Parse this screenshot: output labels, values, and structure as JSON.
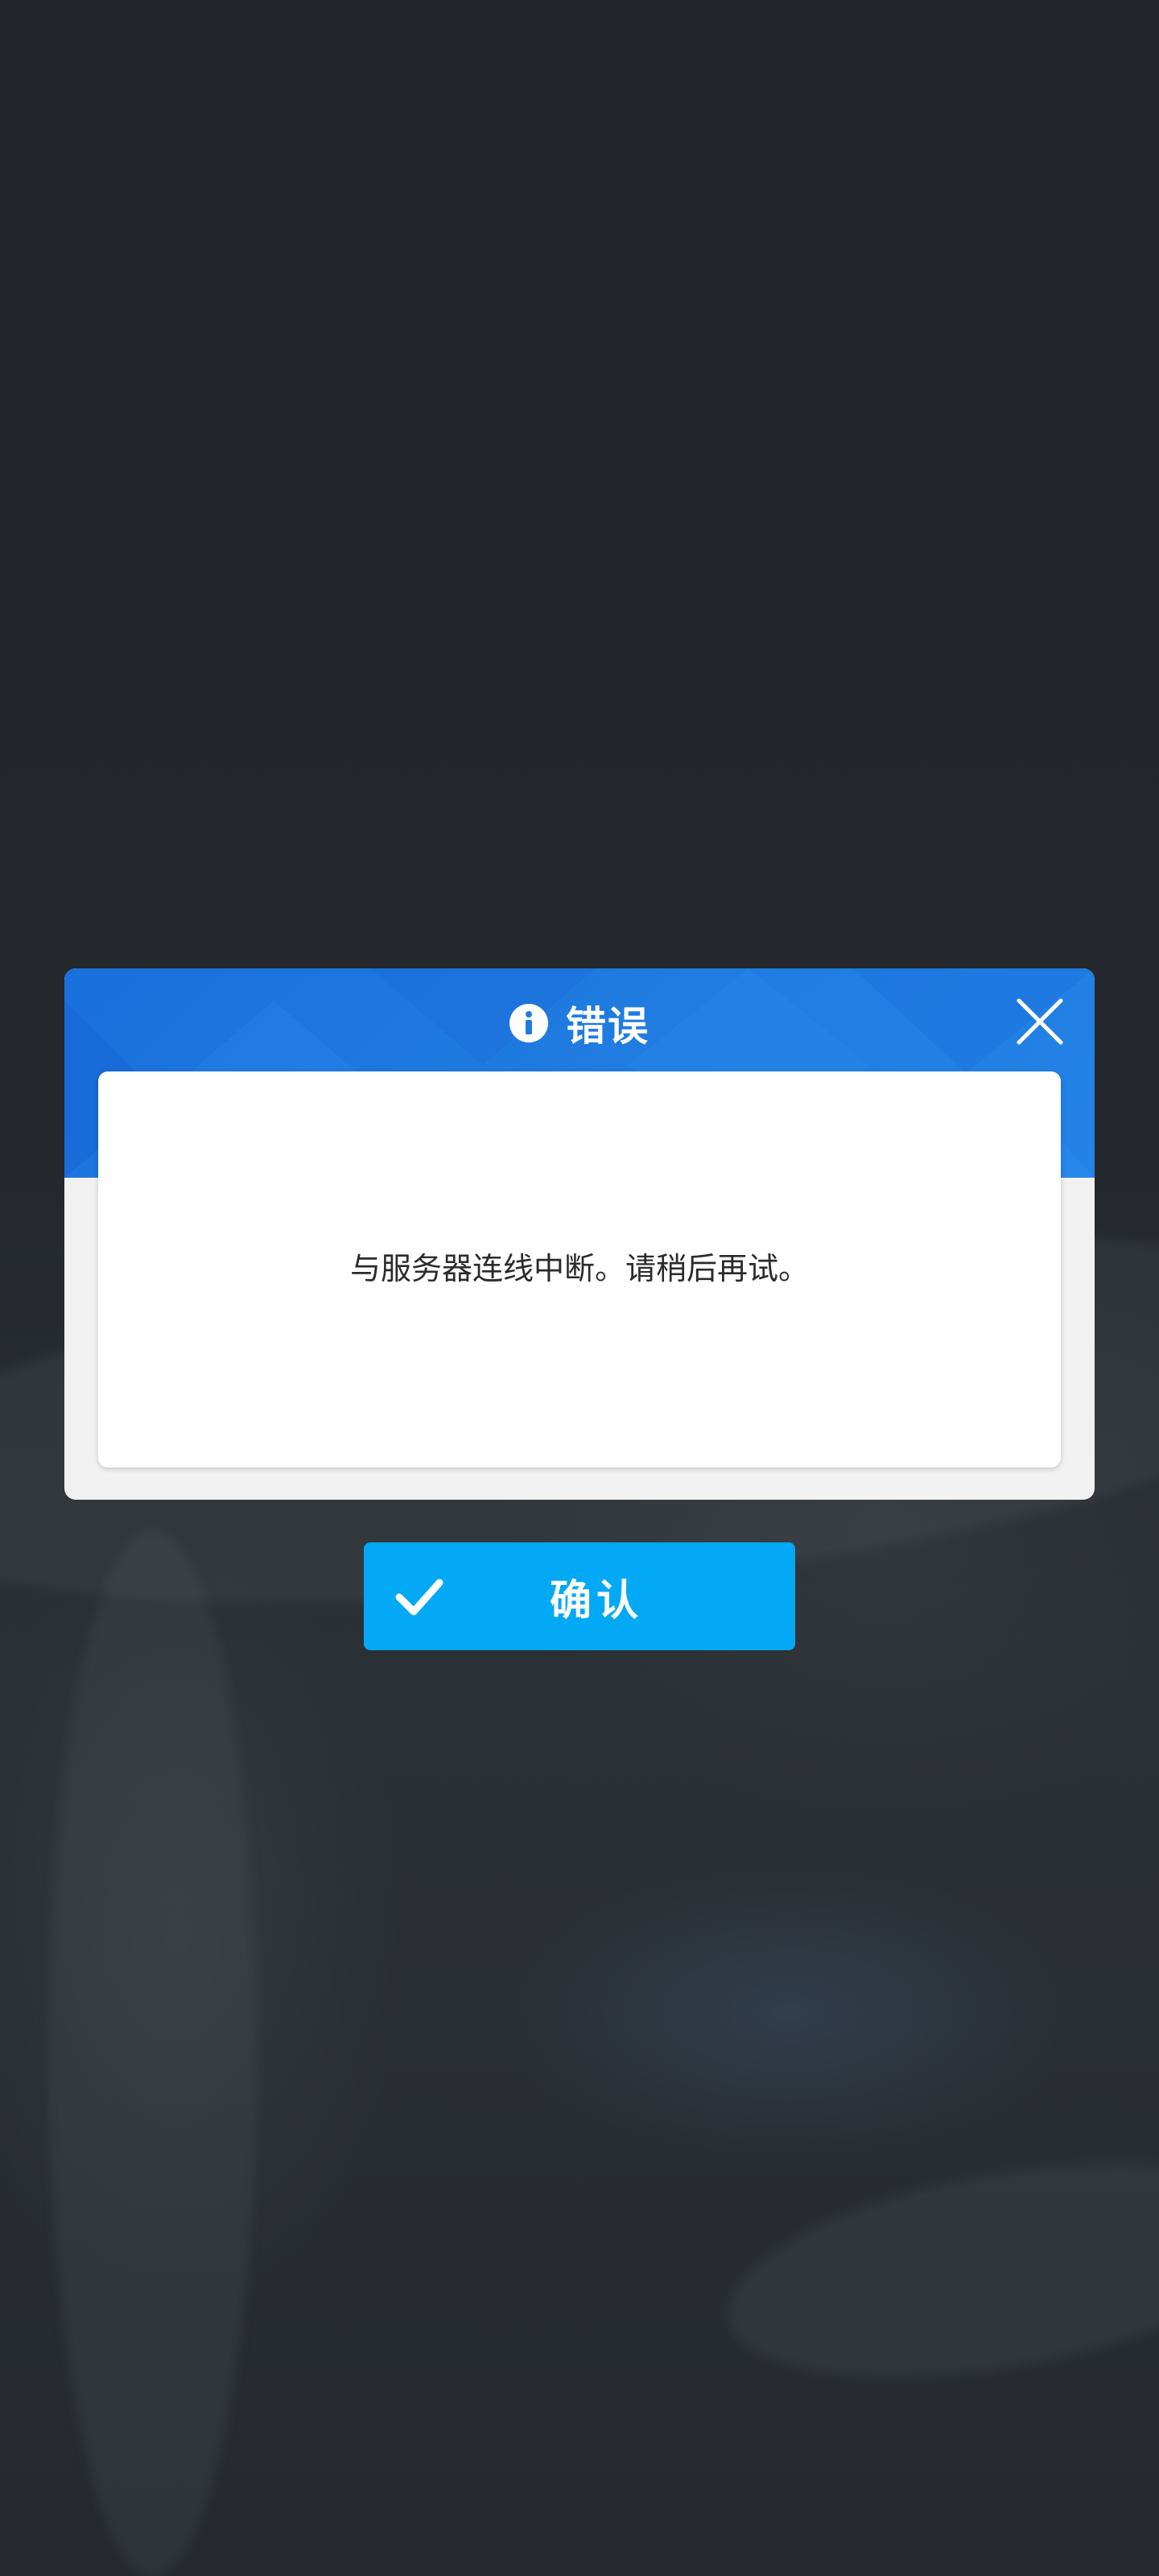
{
  "dialog": {
    "title": "错误",
    "title_icon": "info-icon",
    "close_icon": "close-icon",
    "message": "与服务器连线中断。请稍后再试。"
  },
  "confirm": {
    "label": "确认",
    "icon": "check-icon"
  },
  "colors": {
    "header_blue": "#1f7ae0",
    "confirm_blue": "#03a9f4",
    "dialog_body": "#f1f1f1",
    "backdrop": "#23272b"
  }
}
